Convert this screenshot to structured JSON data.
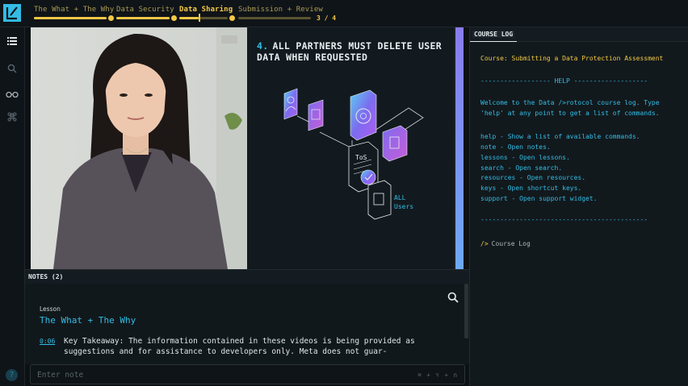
{
  "header": {
    "breadcrumbs": [
      {
        "label": "The What + The Why",
        "state": "done"
      },
      {
        "label": "Data Security",
        "state": "done"
      },
      {
        "label": "Data Sharing",
        "state": "active"
      },
      {
        "label": "Submission + Review",
        "state": "todo"
      }
    ],
    "lesson_count": "3 / 4",
    "accent_color": "#f3c845"
  },
  "rail": {
    "icons": [
      "list-icon",
      "search-icon",
      "glasses-icon",
      "command-icon"
    ],
    "help_label": "?"
  },
  "video": {
    "slide": {
      "number": "4.",
      "title": "ALL PARTNERS MUST DELETE USER DATA WHEN REQUESTED",
      "doc_label": "ToS",
      "caption_line1": "ALL",
      "caption_line2": "Users"
    }
  },
  "notes": {
    "tab_label": "NOTES (2)",
    "kicker": "Lesson",
    "heading": "The What + The Why",
    "entry": {
      "timestamp": "0:06",
      "text": "Key Takeaway: The information contained in these videos is being provided as suggestions and for assistance to developers only. Meta does not guar-"
    },
    "input_placeholder": "Enter note",
    "shortcut": "⌘ + ⌥ + n"
  },
  "course_log": {
    "tab_label": "COURSE LOG",
    "course": "Course: Submitting a Data Protection Assessment",
    "help_rule": "------------------ HELP -------------------",
    "intro_line1": "Welcome to the Data />rotocol course log. Type",
    "intro_line2": "'help' at any point to get a list of commands.",
    "commands": [
      "help - Show a list of available commands.",
      "note - Open notes.",
      "lessons - Open lessons.",
      "search - Open search.",
      "resources - Open resources.",
      "keys - Open shortcut keys.",
      "support - Open support widget."
    ],
    "end_rule": "-------------------------------------------",
    "prompt_caret": "/>",
    "prompt_text": "Course Log"
  }
}
